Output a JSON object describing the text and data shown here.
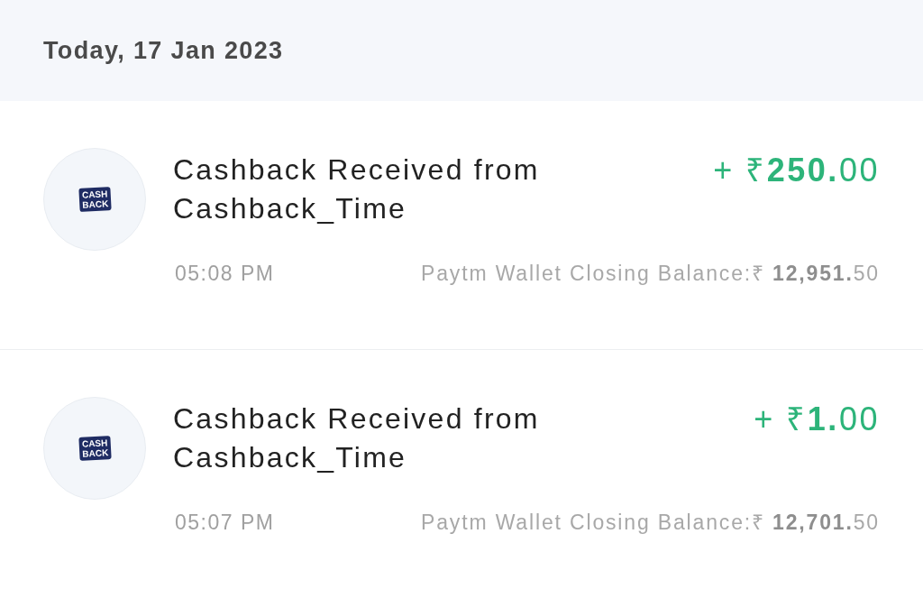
{
  "date_header": "Today, 17 Jan 2023",
  "transactions": [
    {
      "logo_text": [
        "CASH",
        "BACK"
      ],
      "title": "Cashback Received from Cashback_Time",
      "amount": "+ ₹**250.**00",
      "time": "05:08 PM",
      "balance": "Paytm Wallet Closing Balance:₹ **12,951.**50"
    },
    {
      "logo_text": [
        "CASH",
        "BACK"
      ],
      "title": "Cashback Received from Cashback_Time",
      "amount": "+ ₹**1.**00",
      "time": "05:07 PM",
      "balance": "Paytm Wallet Closing Balance:₹ **12,701.**50"
    }
  ]
}
